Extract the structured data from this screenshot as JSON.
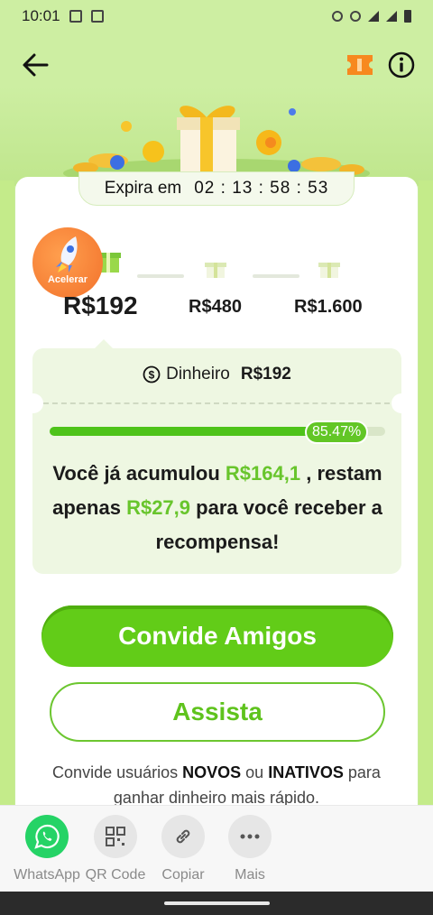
{
  "status_bar": {
    "time": "10:01"
  },
  "header": {
    "back_icon": "arrow-left-icon",
    "ticket_icon": "ticket-icon",
    "info_icon": "info-icon"
  },
  "expira": {
    "label": "Expira em",
    "timer": "02 : 13 : 58 : 53"
  },
  "rocket": {
    "label": "Acelerar"
  },
  "tiers": [
    "R$192",
    "R$480",
    "R$1.600"
  ],
  "cash": {
    "label": "Dinheiro",
    "amount": "R$192"
  },
  "progress": {
    "fraction": 0.8547,
    "label": "85.47%"
  },
  "message": {
    "part1": "Você já acumulou",
    "accum": "R$164,1",
    "part2": ", restam apenas",
    "remaining": "R$27,9",
    "part3": "para você receber a recompensa!"
  },
  "buttons": {
    "invite": "Convide Amigos",
    "watch": "Assista"
  },
  "hint": {
    "p1": "Convide usuários",
    "new": "NOVOS",
    "p2": "ou",
    "inactive": "INATIVOS",
    "p3": "para ganhar dinheiro mais rápido."
  },
  "share": [
    {
      "label": "WhatsApp",
      "icon": "whatsapp-icon"
    },
    {
      "label": "QR Code",
      "icon": "qr-code-icon"
    },
    {
      "label": "Copiar",
      "icon": "link-icon"
    },
    {
      "label": "Mais",
      "icon": "more-dots-icon"
    }
  ],
  "colors": {
    "accent": "#62cc18",
    "accent_text": "#68c52c",
    "background": "#c7ec9a",
    "rocket": "#f2712b"
  }
}
